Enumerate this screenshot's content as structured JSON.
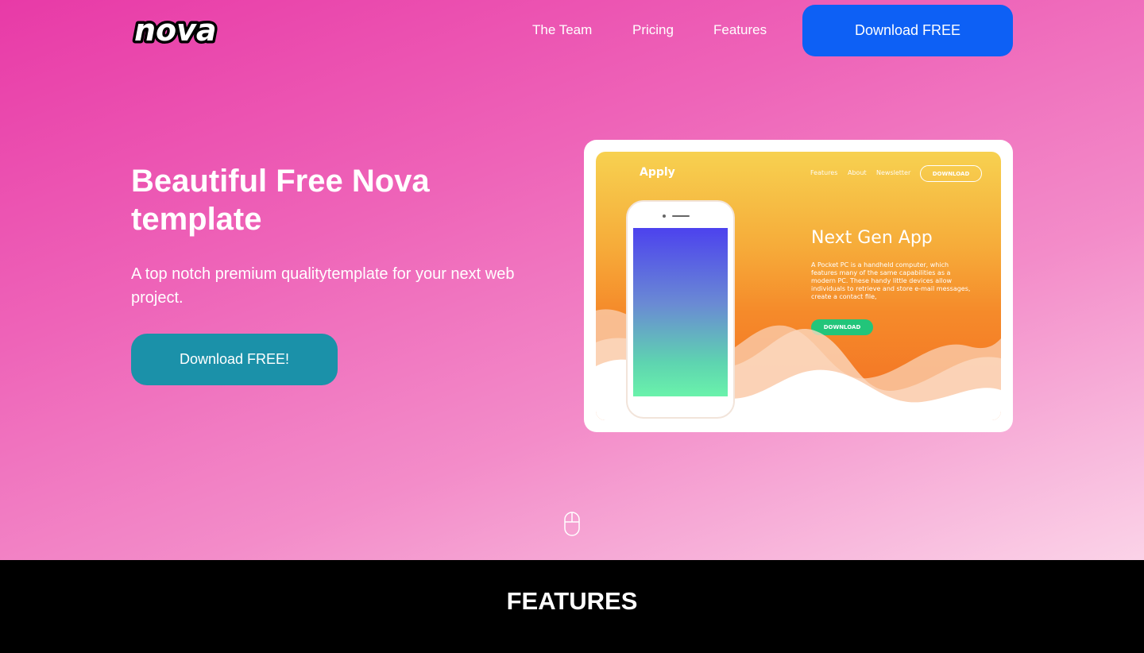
{
  "brand": {
    "logo_text": "nova"
  },
  "nav": {
    "links": [
      "The Team",
      "Pricing",
      "Features"
    ],
    "cta_label": "Download FREE"
  },
  "hero": {
    "title": "Beautiful Free Nova template",
    "subtitle": "A top notch premium qualitytemplate for your next web project.",
    "cta_label": "Download FREE!"
  },
  "preview": {
    "brand": "Apply",
    "nav_links": [
      "Features",
      "About",
      "Newsletter"
    ],
    "nav_button": "DOWNLOAD",
    "heading": "Next Gen App",
    "text": "A Pocket PC is a handheld computer, which features many of the same capabilities as a modern PC. These handy little devices allow individuals to retrieve and store e-mail messages, create a contact file,",
    "button": "DOWNLOAD"
  },
  "features": {
    "title": "FEATURES"
  },
  "icons": {
    "scroll": "mouse-scroll-icon"
  },
  "colors": {
    "nav_cta": "#0d60f5",
    "hero_cta": "#1b91a9",
    "preview_button": "#22c57a"
  }
}
